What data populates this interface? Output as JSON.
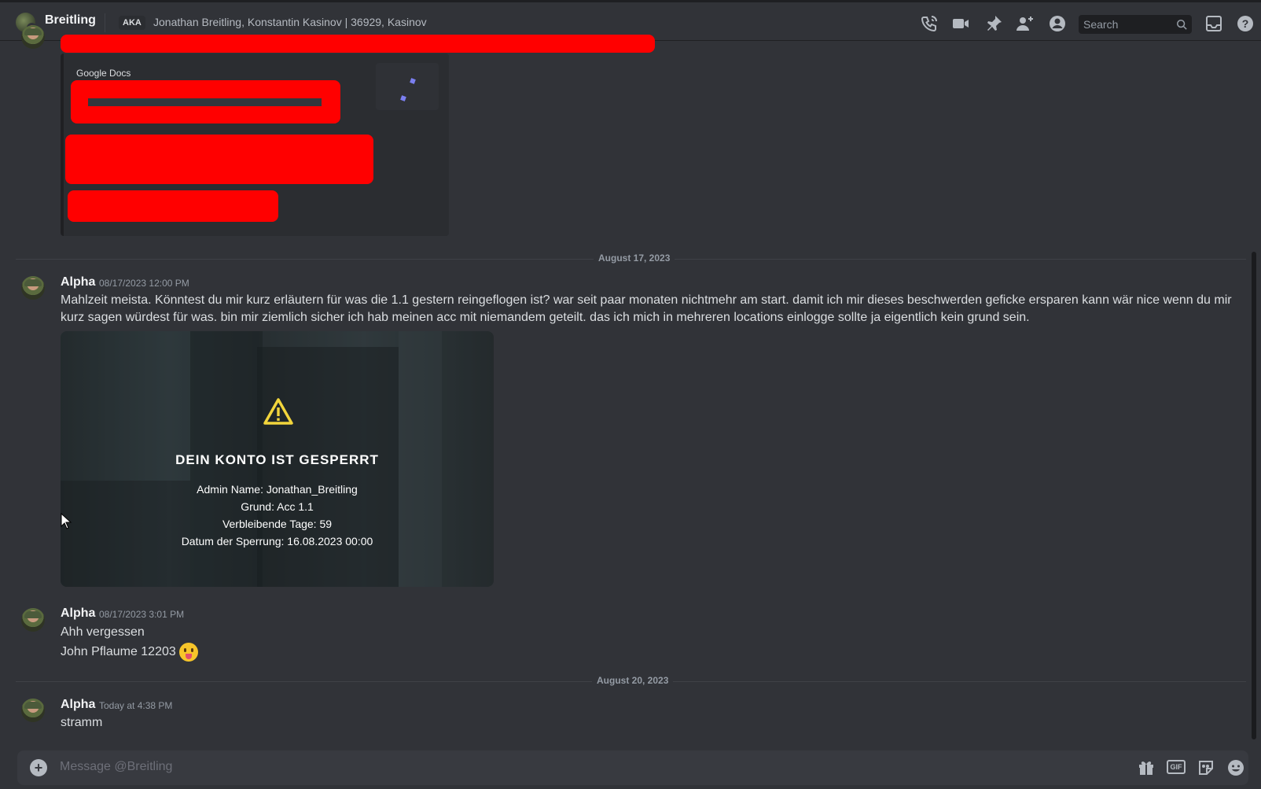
{
  "header": {
    "dm_name": "Breitling",
    "aka_label": "AKA",
    "aka_names": "Jonathan Breitling, Konstantin Kasinov | 36929, Kasinov",
    "search_placeholder": "Search",
    "icons": [
      "call-icon",
      "video-icon",
      "pin-icon",
      "add-friend-icon",
      "profile-icon",
      "search-icon",
      "inbox-icon",
      "help-icon"
    ]
  },
  "embed": {
    "provider": "Google Docs"
  },
  "separators": {
    "first": "August 17, 2023",
    "second": "August 20, 2023"
  },
  "messages": [
    {
      "author": "Alpha",
      "timestamp": "08/17/2023 12:00 PM",
      "text": "Mahlzeit meista. Könntest du mir kurz erläutern für was die 1.1 gestern reingeflogen ist? war seit paar monaten nichtmehr am start. damit ich mir dieses beschwerden geficke ersparen kann wär nice wenn du mir kurz sagen würdest für was. bin mir ziemlich sicher ich hab meinen acc mit niemandem geteilt. das ich mich in mehreren locations einlogge sollte ja eigentlich kein grund sein."
    },
    {
      "author": "Alpha",
      "timestamp": "08/17/2023 3:01 PM",
      "line1": "Ahh vergessen",
      "line2": "John Pflaume 12203"
    },
    {
      "author": "Alpha",
      "timestamp": "Today at 4:38 PM",
      "text": "stramm"
    }
  ],
  "ban_image": {
    "title": "DEIN KONTO IST GESPERRT",
    "admin": "Admin Name: Jonathan_Breitling",
    "reason": "Grund: Acc 1.1",
    "days": "Verbleibende Tage: 59",
    "date": "Datum der Sperrung: 16.08.2023 00:00"
  },
  "composer": {
    "placeholder": "Message @Breitling",
    "gif_label": "GIF"
  },
  "colors": {
    "background": "#313338",
    "redaction": "#ff0000",
    "dnd_status": "#f23f43"
  }
}
